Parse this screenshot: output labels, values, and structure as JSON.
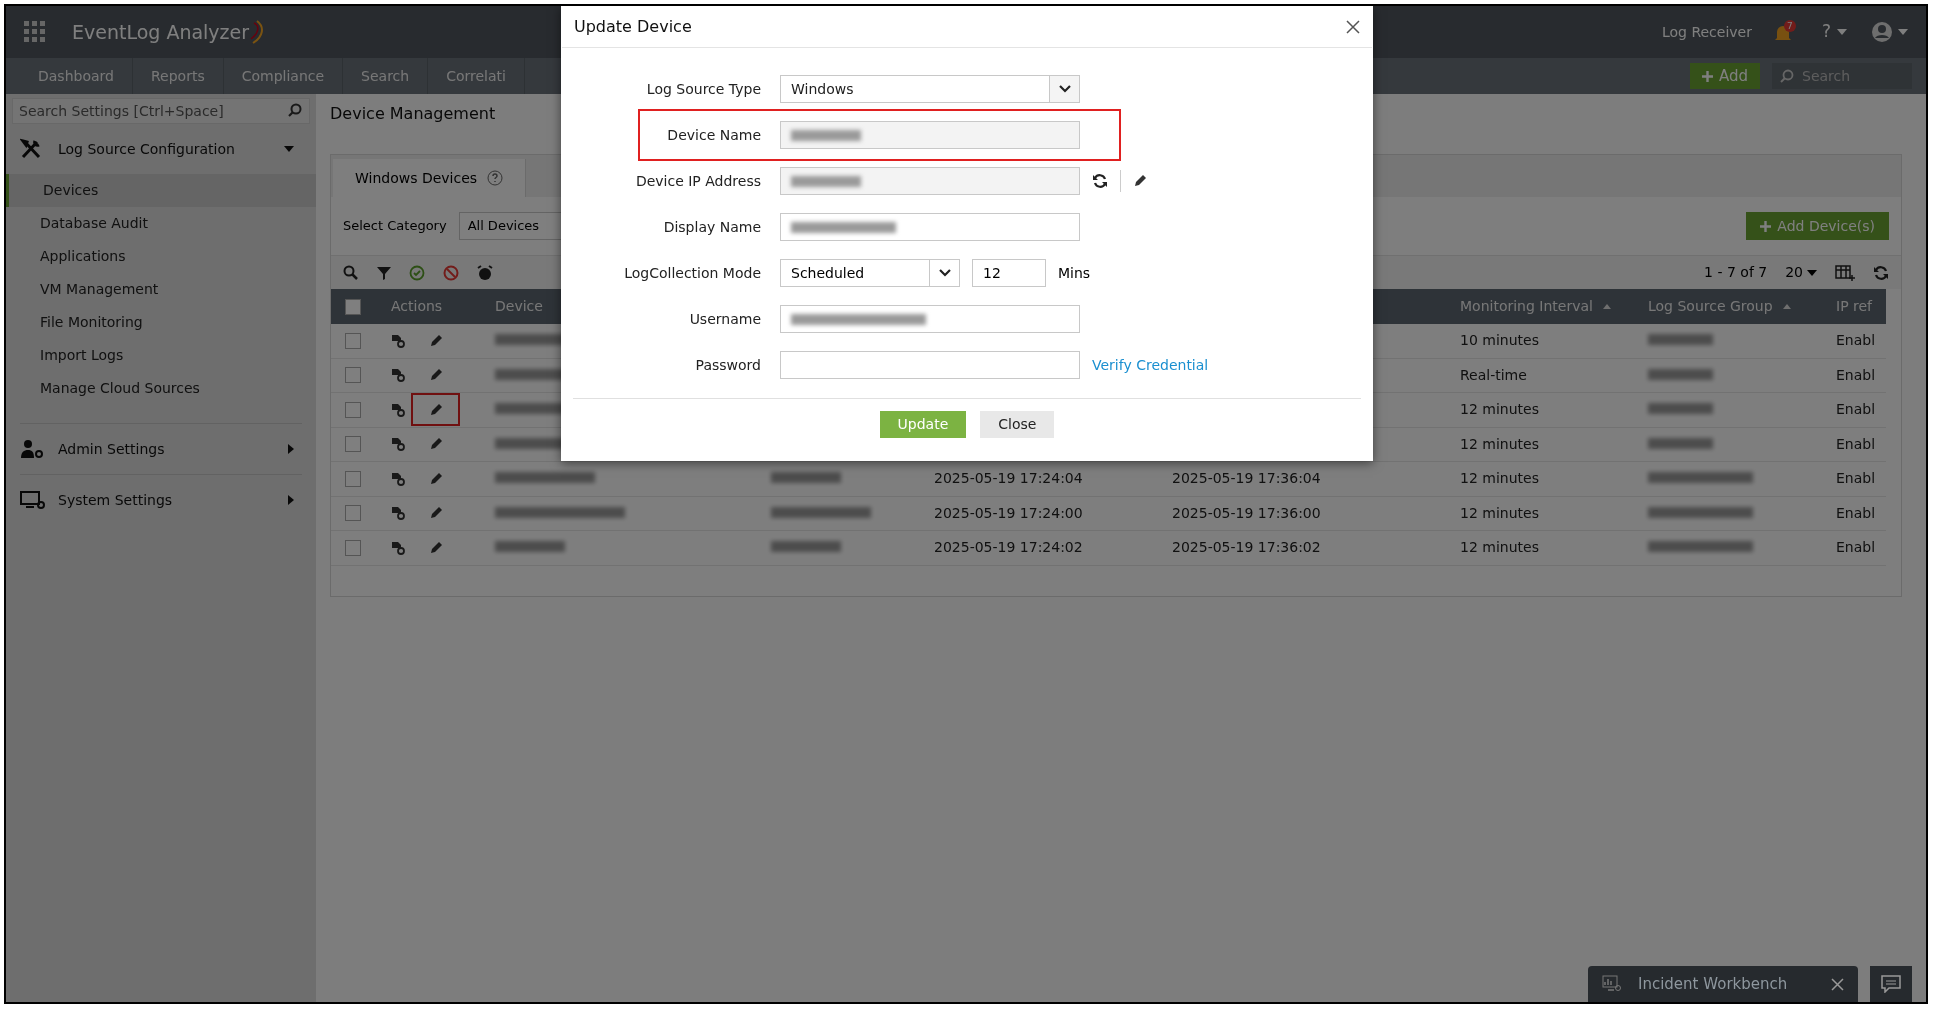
{
  "header": {
    "logo": "EventLog Analyzer",
    "nav_tabs": [
      {
        "label": "Dashboard",
        "selected": false
      },
      {
        "label": "Reports",
        "selected": false
      },
      {
        "label": "Compliance",
        "selected": false
      },
      {
        "label": "Search",
        "selected": false
      },
      {
        "label": "Correlati",
        "selected": false
      }
    ],
    "log_receiver": "Log Receiver",
    "notification_count": "7",
    "help": "?",
    "add_button": "Add",
    "search": {
      "placeholder": "Search"
    }
  },
  "sidebar": {
    "search": {
      "placeholder": "Search Settings [Ctrl+Space]"
    },
    "sections": [
      {
        "label": "Log Source Configuration",
        "expanded": true,
        "items": [
          {
            "label": "Devices",
            "selected": true
          },
          {
            "label": "Database Audit",
            "selected": false
          },
          {
            "label": "Applications",
            "selected": false
          },
          {
            "label": "VM Management",
            "selected": false
          },
          {
            "label": "File Monitoring",
            "selected": false
          },
          {
            "label": "Import Logs",
            "selected": false
          },
          {
            "label": "Manage Cloud Sources",
            "selected": false
          }
        ]
      },
      {
        "label": "Admin Settings",
        "expanded": false
      },
      {
        "label": "System Settings",
        "expanded": false
      }
    ]
  },
  "page": {
    "title": "Device Management",
    "tab": "Windows Devices",
    "category_label": "Select Category",
    "category_value": "All Devices",
    "add_devices": "Add Device(s)",
    "pager": "1 - 7 of 7",
    "page_size": "20"
  },
  "table": {
    "all_checked": false,
    "columns": {
      "actions": "Actions",
      "device": "Device",
      "monitoring_interval": "Monitoring Interval",
      "log_source_group": "Log Source Group",
      "column_9": "IP ref"
    },
    "rows": [
      {
        "checked": false,
        "edit_highlighted": false,
        "monitoring_interval": "10 minutes",
        "column_9": "Enabl"
      },
      {
        "checked": false,
        "edit_highlighted": false,
        "monitoring_interval": "Real-time",
        "column_9": "Enabl"
      },
      {
        "checked": false,
        "edit_highlighted": true,
        "monitoring_interval": "12 minutes",
        "column_9": "Enabl"
      },
      {
        "checked": false,
        "edit_highlighted": false,
        "monitoring_interval": "12 minutes",
        "column_9": "Enabl"
      },
      {
        "checked": false,
        "edit_highlighted": false,
        "column_5": "2025-05-19 17:24:04",
        "column_6": "2025-05-19 17:36:04",
        "monitoring_interval": "12 minutes",
        "column_9": "Enabl"
      },
      {
        "checked": false,
        "edit_highlighted": false,
        "column_5": "2025-05-19 17:24:00",
        "column_6": "2025-05-19 17:36:00",
        "monitoring_interval": "12 minutes",
        "column_9": "Enabl"
      },
      {
        "checked": false,
        "edit_highlighted": false,
        "column_5": "2025-05-19 17:24:02",
        "column_6": "2025-05-19 17:36:02",
        "monitoring_interval": "12 minutes",
        "column_9": "Enabl"
      }
    ]
  },
  "dialog": {
    "title": "Update Device",
    "fields": [
      {
        "kind": "select",
        "label": "Log Source Type",
        "value": "Windows",
        "highlighted": false
      },
      {
        "kind": "readonly",
        "label": "Device Name",
        "masked": true,
        "highlighted": true
      },
      {
        "kind": "ip",
        "label": "Device IP Address",
        "masked": true,
        "highlighted": false
      },
      {
        "kind": "text",
        "label": "Display Name",
        "masked": true,
        "highlighted": false
      },
      {
        "kind": "mode",
        "label": "LogCollection Mode",
        "value": "Scheduled",
        "interval": "12",
        "unit": "Mins",
        "highlighted": false
      },
      {
        "kind": "text",
        "label": "Username",
        "masked": true,
        "highlighted": false
      },
      {
        "kind": "password",
        "label": "Password",
        "link": "Verify Credential",
        "highlighted": false
      }
    ],
    "buttons": [
      {
        "label": "Update",
        "primary": true
      },
      {
        "label": "Close",
        "primary": false
      }
    ]
  },
  "workbench": {
    "label": "Incident Workbench"
  }
}
